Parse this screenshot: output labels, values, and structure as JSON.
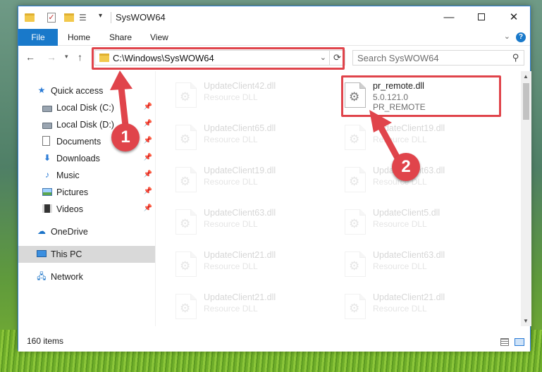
{
  "window": {
    "title": "SysWOW64",
    "controls": {
      "minimize": "—",
      "maximize": "",
      "close": "✕"
    }
  },
  "quick_access_toolbar": {
    "icons": [
      "folder-icon",
      "properties-check-icon",
      "new-folder-icon",
      "customize-icon"
    ],
    "dropdown": "▾"
  },
  "ribbon": {
    "tabs": [
      "File",
      "Home",
      "Share",
      "View"
    ],
    "expand_chevron": "⌄",
    "help": "?"
  },
  "navigation": {
    "back": "←",
    "forward": "→",
    "recent": "▾",
    "up": "↑"
  },
  "address_bar": {
    "path": "C:\\Windows\\SysWOW64",
    "dropdown": "⌄",
    "refresh": "⟳"
  },
  "search": {
    "placeholder": "Search SysWOW64",
    "icon": "⚲"
  },
  "sidebar": {
    "items": [
      {
        "label": "Quick access",
        "icon": "star-icon",
        "glyph": "★",
        "pinned": false
      },
      {
        "label": "Local Disk (C:)",
        "icon": "drive-icon",
        "glyph": "",
        "pinned": true
      },
      {
        "label": "Local Disk (D:)",
        "icon": "drive-icon",
        "glyph": "",
        "pinned": true
      },
      {
        "label": "Documents",
        "icon": "documents-icon",
        "glyph": "",
        "pinned": true
      },
      {
        "label": "Downloads",
        "icon": "download-icon",
        "glyph": "⬇",
        "pinned": true
      },
      {
        "label": "Music",
        "icon": "music-icon",
        "glyph": "♪",
        "pinned": true
      },
      {
        "label": "Pictures",
        "icon": "pictures-icon",
        "glyph": "",
        "pinned": true
      },
      {
        "label": "Videos",
        "icon": "videos-icon",
        "glyph": "",
        "pinned": true
      },
      {
        "label": "OneDrive",
        "icon": "onedrive-icon",
        "glyph": "☁",
        "pinned": false
      },
      {
        "label": "This PC",
        "icon": "this-pc-icon",
        "glyph": "",
        "pinned": false,
        "selected": true
      },
      {
        "label": "Network",
        "icon": "network-icon",
        "glyph": "🖧",
        "pinned": false
      }
    ],
    "pin_glyph": "📌"
  },
  "files": [
    {
      "name": "UpdateClient42.dll",
      "line2": "Resource DLL",
      "line3": "",
      "faded": true
    },
    {
      "name": "pr_remote.dll",
      "line2": "5.0.121.0",
      "line3": "PR_REMOTE",
      "faded": false,
      "highlighted": true
    },
    {
      "name": "UpdateClient65.dll",
      "line2": "Resource DLL",
      "line3": "",
      "faded": true
    },
    {
      "name": "UpdateClient19.dll",
      "line2": "Resource DLL",
      "line3": "",
      "faded": true
    },
    {
      "name": "UpdateClient19.dll",
      "line2": "Resource DLL",
      "line3": "",
      "faded": true
    },
    {
      "name": "UpdateClient63.dll",
      "line2": "Resource DLL",
      "line3": "",
      "faded": true
    },
    {
      "name": "UpdateClient63.dll",
      "line2": "Resource DLL",
      "line3": "",
      "faded": true
    },
    {
      "name": "UpdateClient5.dll",
      "line2": "Resource DLL",
      "line3": "",
      "faded": true
    },
    {
      "name": "UpdateClient21.dll",
      "line2": "Resource DLL",
      "line3": "",
      "faded": true
    },
    {
      "name": "UpdateClient63.dll",
      "line2": "Resource DLL",
      "line3": "",
      "faded": true
    },
    {
      "name": "UpdateClient21.dll",
      "line2": "Resource DLL",
      "line3": "",
      "faded": true
    },
    {
      "name": "UpdateClient21.dll",
      "line2": "Resource DLL",
      "line3": "",
      "faded": true
    }
  ],
  "status": {
    "item_count": "160 items",
    "views": [
      "details-view-icon",
      "tiles-view-icon"
    ]
  },
  "scrollbar": {
    "up": "▲",
    "down": "▼"
  },
  "annotations": {
    "step1": "1",
    "step2": "2",
    "color": "#e0444b"
  },
  "colors": {
    "accent": "#1979ca",
    "highlight": "#e0444b",
    "selected_nav": "#d9d9d9"
  }
}
